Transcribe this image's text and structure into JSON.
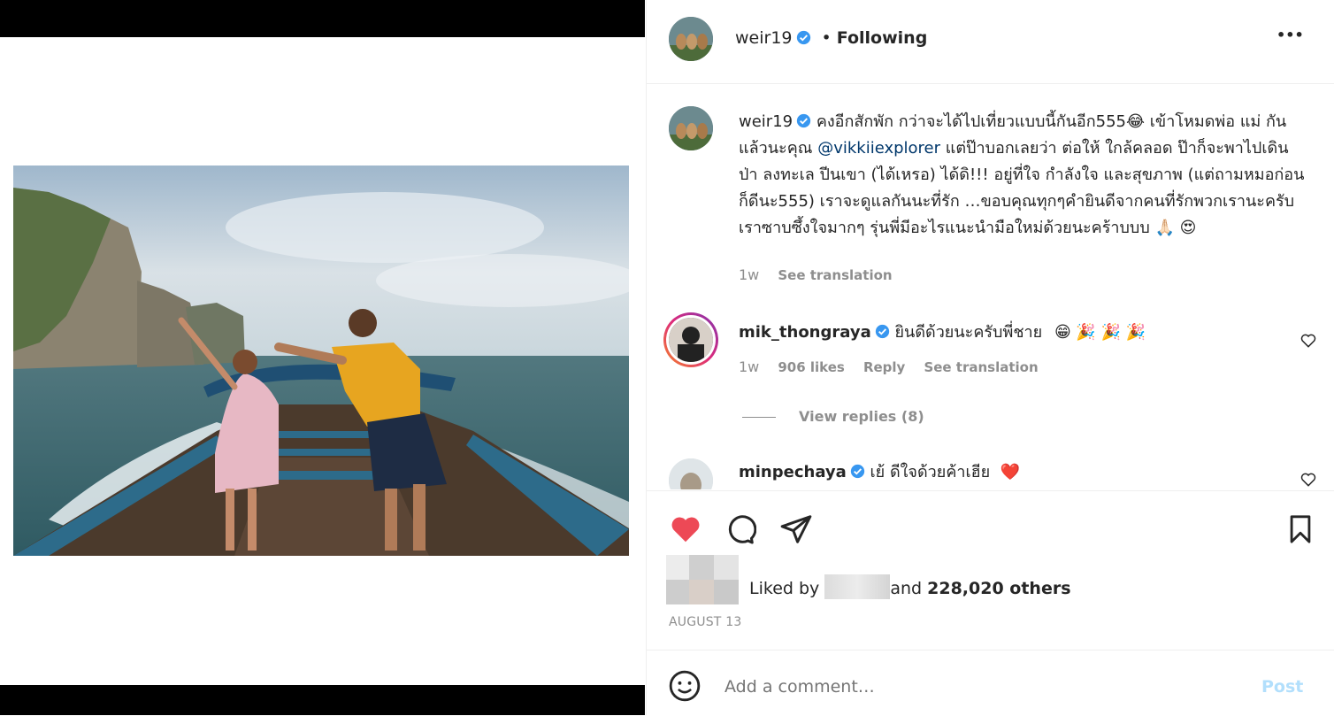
{
  "post": {
    "username": "weir19",
    "follow_status": "Following",
    "separator": "•",
    "more_label": "•••"
  },
  "caption": {
    "username": "weir19",
    "text_part1": "คงอีกสักพัก กว่าจะได้ไปเที่ยวแบบนี้กันอีก555",
    "emoji1": "😂",
    "text_part2": " เข้าโหมดพ่อ แม่ กันแล้วนะคุณ ",
    "mention": "@vikkiiexplorer",
    "text_part3": " แต่ป๊าบอกเลยว่า ต่อให้ ใกล้คลอด ป๊าก็จะพาไปเดินป่า ลงทะเล ปีนเขา (ได้เหรอ) ได้ดิ!!! อยู่ที่ใจ กำลังใจ และสุขภาพ (แต่ถามหมอก่อนก็ดีนะ555) เราจะดูแลกันนะที่รัก …ขอบคุณทุกๆคำยินดีจากคนที่รักพวกเรานะครับ เราซาบซึ้งใจมากๆ รุ่นพี่มีอะไรแนะนำมือใหม่ด้วยนะคร้าบบบ ",
    "emoji2": "🙏🏻",
    "emoji3": "😍",
    "time": "1w",
    "see_translation": "See translation"
  },
  "comments": [
    {
      "username": "mik_thongraya",
      "text": "ยินดีด้วยนะครับพี่ชาย",
      "emojis": "😁 🎉 🎉 🎉",
      "time": "1w",
      "likes": "906 likes",
      "reply": "Reply",
      "see_translation": "See translation",
      "view_replies": "View replies (8)"
    },
    {
      "username": "minpechaya",
      "text": "เย้ ดีใจด้วยค้าเฮีย",
      "emojis": "❤️"
    }
  ],
  "likes": {
    "liked_by": "Liked by",
    "and": "and",
    "count_text": "228,020 others"
  },
  "date": "AUGUST 13",
  "add_comment": {
    "placeholder": "Add a comment…",
    "post_label": "Post"
  },
  "colors": {
    "heart_red": "#ed4956",
    "verified_blue": "#3897f0",
    "post_button": "#b2dffc"
  },
  "icons": [
    "heart-filled-icon",
    "comment-icon",
    "share-icon",
    "bookmark-icon",
    "emoji-icon",
    "more-icon",
    "verified-icon",
    "heart-outline-icon"
  ]
}
